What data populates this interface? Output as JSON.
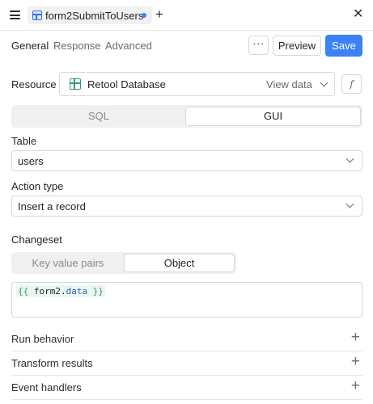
{
  "tabbar": {
    "query_name": "form2SubmitToUsers"
  },
  "subnav": {
    "tabs": [
      {
        "label": "General",
        "active": true
      },
      {
        "label": "Response",
        "active": false
      },
      {
        "label": "Advanced",
        "active": false
      }
    ],
    "more_label": "···",
    "preview_label": "Preview",
    "save_label": "Save"
  },
  "resource": {
    "label": "Resource",
    "name": "Retool Database",
    "view_data_label": "View data",
    "fx_label": "f"
  },
  "mode_toggle": {
    "options": [
      "SQL",
      "GUI"
    ],
    "selected": "GUI"
  },
  "table_field": {
    "label": "Table",
    "value": "users"
  },
  "action_type": {
    "label": "Action type",
    "value": "Insert a record"
  },
  "changeset": {
    "label": "Changeset",
    "options": [
      "Key value pairs",
      "Object"
    ],
    "selected": "Object",
    "code": {
      "open": "{{",
      "object": "form2",
      "dot": ".",
      "property": "data",
      "close": "}}"
    }
  },
  "sections": [
    {
      "label": "Run behavior"
    },
    {
      "label": "Transform results"
    },
    {
      "label": "Event handlers"
    }
  ],
  "colors": {
    "accent": "#3b82f6",
    "resource_icon": "#2f9e7a",
    "code_highlight": "#eaf7ee"
  }
}
